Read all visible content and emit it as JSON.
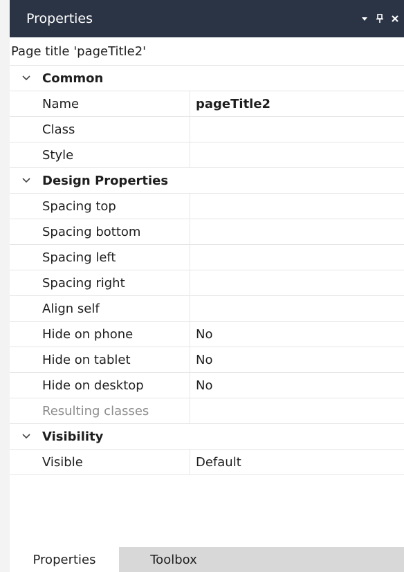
{
  "panel": {
    "title": "Properties",
    "subheader": "Page title 'pageTitle2'"
  },
  "categories": [
    {
      "label": "Common",
      "rows": [
        {
          "name": "Name",
          "value": "pageTitle2",
          "bold": true
        },
        {
          "name": "Class",
          "value": ""
        },
        {
          "name": "Style",
          "value": ""
        }
      ]
    },
    {
      "label": "Design Properties",
      "rows": [
        {
          "name": "Spacing top",
          "value": ""
        },
        {
          "name": "Spacing bottom",
          "value": ""
        },
        {
          "name": "Spacing left",
          "value": ""
        },
        {
          "name": "Spacing right",
          "value": ""
        },
        {
          "name": "Align self",
          "value": ""
        },
        {
          "name": "Hide on phone",
          "value": "No"
        },
        {
          "name": "Hide on tablet",
          "value": "No"
        },
        {
          "name": "Hide on desktop",
          "value": "No"
        },
        {
          "name": "Resulting classes",
          "value": "",
          "disabled": true
        }
      ]
    },
    {
      "label": "Visibility",
      "rows": [
        {
          "name": "Visible",
          "value": "Default"
        }
      ]
    }
  ],
  "tabs": {
    "properties": "Properties",
    "toolbox": "Toolbox"
  },
  "colors": {
    "title_bar": "#2b3445",
    "grid_line": "#e6e6e6",
    "inactive_tab": "#d8d8d8"
  }
}
